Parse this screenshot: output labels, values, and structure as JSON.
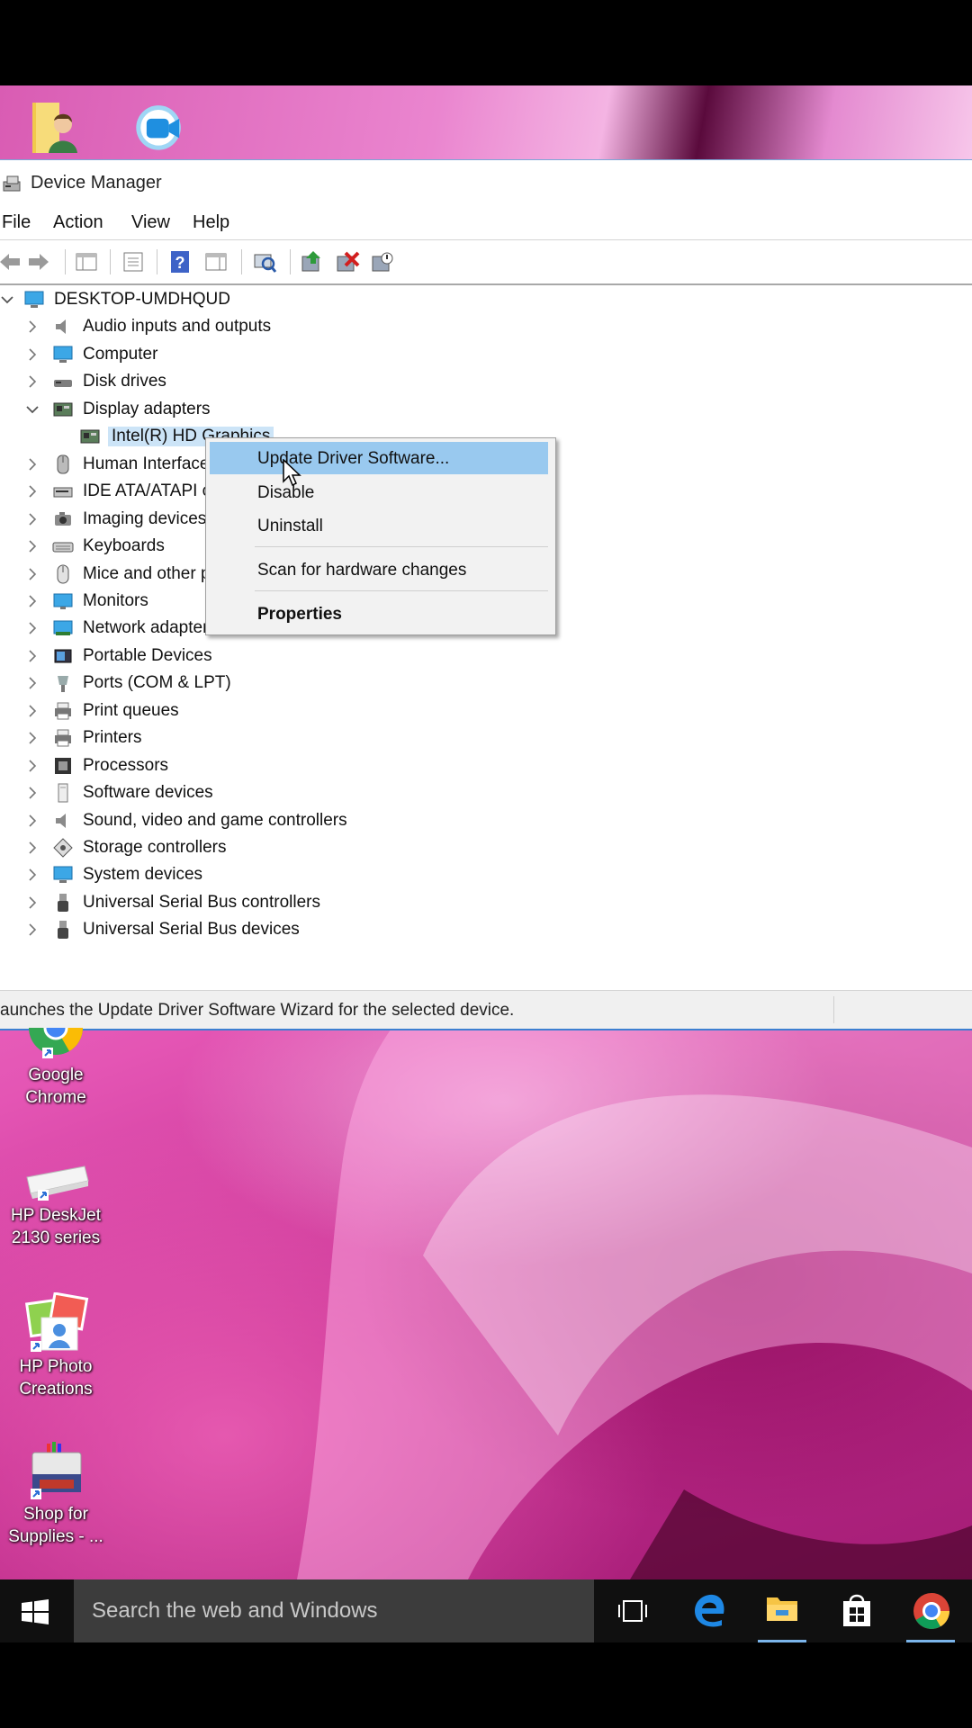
{
  "window": {
    "title": "Device Manager",
    "menu": [
      "File",
      "Action",
      "View",
      "Help"
    ]
  },
  "tree": {
    "root": "DESKTOP-UMDHQUD",
    "items": [
      {
        "label": "Audio inputs and outputs",
        "icon": "speaker-icon"
      },
      {
        "label": "Computer",
        "icon": "computer-icon"
      },
      {
        "label": "Disk drives",
        "icon": "disk-drive-icon"
      },
      {
        "label": "Display adapters",
        "icon": "display-adapter-icon"
      },
      {
        "label": "Intel(R) HD Graphics",
        "icon": "display-adapter-icon"
      },
      {
        "label": "Human Interface Devices",
        "icon": "hid-icon"
      },
      {
        "label": "IDE ATA/ATAPI controllers",
        "icon": "ide-controller-icon"
      },
      {
        "label": "Imaging devices",
        "icon": "camera-icon"
      },
      {
        "label": "Keyboards",
        "icon": "keyboard-icon"
      },
      {
        "label": "Mice and other pointing devices",
        "icon": "mouse-icon"
      },
      {
        "label": "Monitors",
        "icon": "monitor-icon"
      },
      {
        "label": "Network adapters",
        "icon": "network-adapter-icon"
      },
      {
        "label": "Portable Devices",
        "icon": "portable-device-icon"
      },
      {
        "label": "Ports (COM & LPT)",
        "icon": "port-icon"
      },
      {
        "label": "Print queues",
        "icon": "printer-icon"
      },
      {
        "label": "Printers",
        "icon": "printer-icon"
      },
      {
        "label": "Processors",
        "icon": "processor-icon"
      },
      {
        "label": "Software devices",
        "icon": "software-device-icon"
      },
      {
        "label": "Sound, video and game controllers",
        "icon": "speaker-icon"
      },
      {
        "label": "Storage controllers",
        "icon": "storage-controller-icon"
      },
      {
        "label": "System devices",
        "icon": "computer-icon"
      },
      {
        "label": "Universal Serial Bus controllers",
        "icon": "usb-icon"
      },
      {
        "label": "Universal Serial Bus devices",
        "icon": "usb-icon"
      }
    ]
  },
  "context_menu": {
    "update": "Update Driver Software...",
    "disable": "Disable",
    "uninstall": "Uninstall",
    "scan": "Scan for hardware changes",
    "properties": "Properties"
  },
  "status": "aunches the Update Driver Software Wizard for the selected device.",
  "desktop_icons": [
    {
      "line1": "Google",
      "line2": "Chrome"
    },
    {
      "line1": "HP DeskJet",
      "line2": "2130 series"
    },
    {
      "line1": "HP Photo",
      "line2": "Creations"
    },
    {
      "line1": "Shop for",
      "line2": "Supplies - ..."
    }
  ],
  "taskbar": {
    "search_placeholder": "Search the web and Windows"
  },
  "colors": {
    "selection": "#99c9ef",
    "accent": "#3d7fd1",
    "taskbar": "#101010"
  }
}
